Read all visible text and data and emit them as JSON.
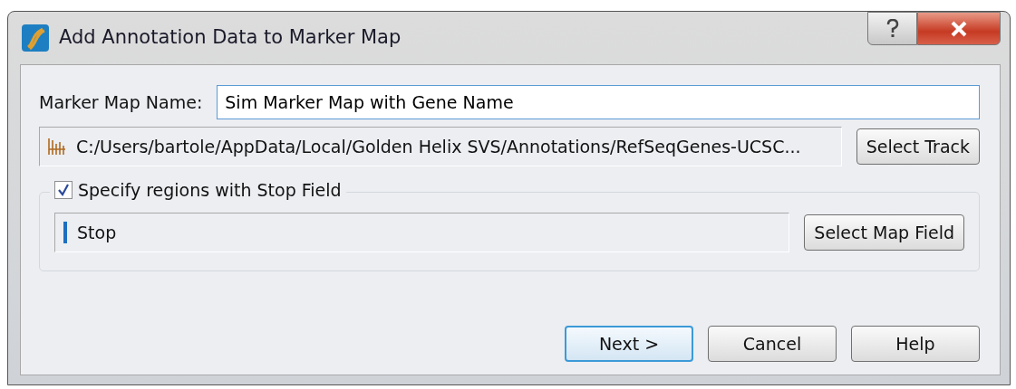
{
  "window": {
    "title": "Add Annotation Data to Marker Map"
  },
  "marker_map_name": {
    "label": "Marker Map Name:",
    "value": "Sim Marker Map with Gene Name"
  },
  "track": {
    "path": "C:/Users/bartole/AppData/Local/Golden Helix SVS/Annotations/RefSeqGenes-UCSC...",
    "button": "Select Track"
  },
  "stop_field_group": {
    "label": "Specify regions with Stop Field",
    "checked": true,
    "field": "Stop",
    "button": "Select Map Field"
  },
  "buttons": [
    {
      "label": "Next >",
      "default": true
    },
    {
      "label": "Cancel",
      "default": false
    },
    {
      "label": "Help",
      "default": false
    }
  ]
}
